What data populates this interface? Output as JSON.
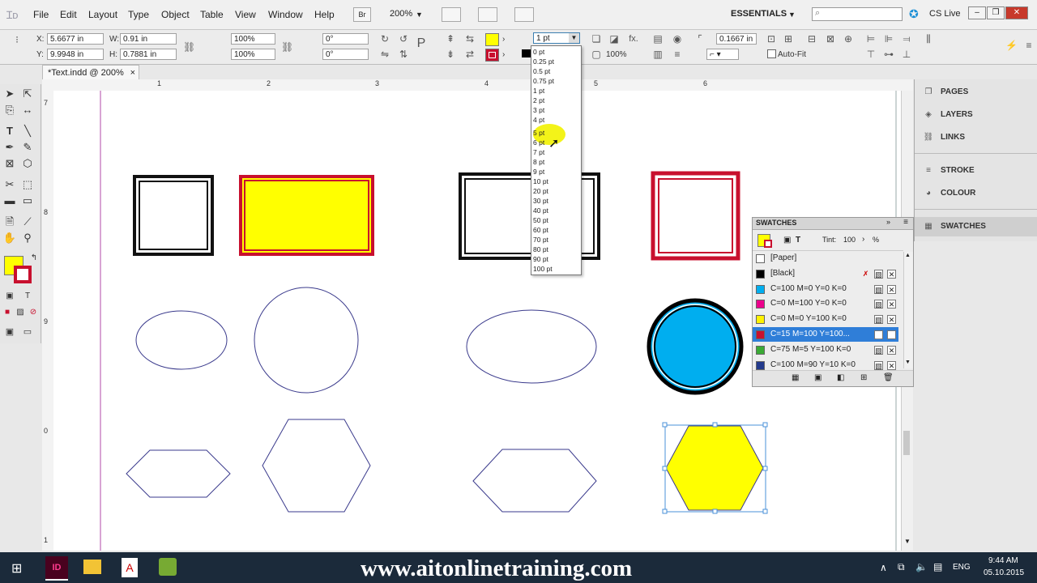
{
  "menubar": {
    "items": [
      "File",
      "Edit",
      "Layout",
      "Type",
      "Object",
      "Table",
      "View",
      "Window",
      "Help"
    ],
    "bridge_label": "Br",
    "zoom": "200%",
    "workspace": "ESSENTIALS",
    "cs_live": "CS Live"
  },
  "controlbar": {
    "x_label": "X:",
    "x_value": "5.6677 in",
    "y_label": "Y:",
    "y_value": "9.9948 in",
    "w_label": "W:",
    "w_value": "0.91 in",
    "h_label": "H:",
    "h_value": "0.7881 in",
    "scale_x": "100%",
    "scale_y": "100%",
    "rotate": "0°",
    "shear": "0°",
    "stroke_weight": "1 pt",
    "offset": "0.1667 in",
    "opacity": "100%",
    "auto_fit": "Auto-Fit",
    "fill_color": "#ffff00",
    "stroke_color": "#c8102e"
  },
  "document": {
    "tab_title": "*Text.indd @ 200%",
    "ruler_h": [
      "1",
      "2",
      "3",
      "4",
      "5",
      "6"
    ],
    "ruler_v": [
      "7",
      "8",
      "9",
      "0",
      "1"
    ]
  },
  "stroke_dropdown": {
    "options": [
      "0 pt",
      "0.25 pt",
      "0.5 pt",
      "0.75 pt",
      "1 pt",
      "2 pt",
      "3 pt",
      "4 pt",
      "5 pt",
      "6 pt",
      "7 pt",
      "8 pt",
      "9 pt",
      "10 pt",
      "20 pt",
      "30 pt",
      "40 pt",
      "50 pt",
      "60 pt",
      "70 pt",
      "80 pt",
      "90 pt",
      "100 pt"
    ],
    "selected": "1 pt",
    "hovered": "5 pt"
  },
  "dock": {
    "items": [
      {
        "label": "PAGES",
        "icon": "pages-icon"
      },
      {
        "label": "LAYERS",
        "icon": "layers-icon"
      },
      {
        "label": "LINKS",
        "icon": "links-icon"
      },
      {
        "label": "STROKE",
        "icon": "stroke-icon"
      },
      {
        "label": "COLOUR",
        "icon": "colour-icon"
      },
      {
        "label": "SWATCHES",
        "icon": "swatches-icon"
      }
    ]
  },
  "swatches": {
    "title": "SWATCHES",
    "tint_label": "Tint:",
    "tint_value": "100",
    "tint_unit": "%",
    "rows": [
      {
        "name": "[Paper]",
        "color": "#ffffff"
      },
      {
        "name": "[Black]",
        "color": "#000000"
      },
      {
        "name": "C=100 M=0 Y=0 K=0",
        "color": "#00aeef"
      },
      {
        "name": "C=0 M=100 Y=0 K=0",
        "color": "#ec008c"
      },
      {
        "name": "C=0 M=0 Y=100 K=0",
        "color": "#fff200"
      },
      {
        "name": "C=15 M=100 Y=100...",
        "color": "#c8102e"
      },
      {
        "name": "C=75 M=5 Y=100 K=0",
        "color": "#3aaa35"
      },
      {
        "name": "C=100 M=90 Y=10 K=0",
        "color": "#233a8c"
      }
    ],
    "selected_index": 5
  },
  "taskbar": {
    "watermark": "www.aitonlinetraining.com",
    "lang": "ENG",
    "time": "9:44 AM",
    "date": "05.10.2015"
  }
}
